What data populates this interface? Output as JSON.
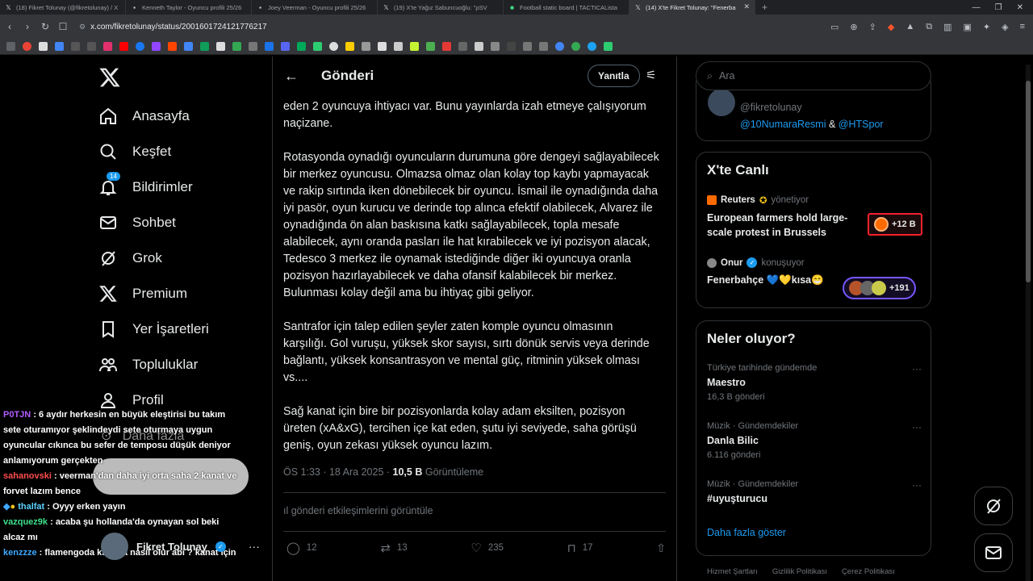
{
  "browser": {
    "tabs": [
      {
        "label": "(18) Fikret Tolunay (@fikretolunay) / X",
        "active": false
      },
      {
        "label": "Kenneth Taylor - Oyuncu profili 25/26",
        "active": false
      },
      {
        "label": "Joey Veerman - Oyuncu profili 25/26",
        "active": false
      },
      {
        "label": "(19) X'te Yağız Sabuncuoğlu: \"ρSV",
        "active": false
      },
      {
        "label": "Football static board | TACTICALista",
        "active": false
      },
      {
        "label": "(14) X'te Fikret Tolunay: \"Fenerba",
        "active": true
      }
    ],
    "url": "x.com/fikretolunay/status/2001601724121776217"
  },
  "nav": {
    "items": [
      {
        "label": "Anasayfa",
        "icon": "home-icon"
      },
      {
        "label": "Keşfet",
        "icon": "search-icon"
      },
      {
        "label": "Bildirimler",
        "icon": "bell-icon",
        "badge": "14"
      },
      {
        "label": "Sohbet",
        "icon": "mail-icon"
      },
      {
        "label": "Grok",
        "icon": "grok-icon"
      },
      {
        "label": "Premium",
        "icon": "x-icon"
      },
      {
        "label": "Yer İşaretleri",
        "icon": "bookmark-icon"
      },
      {
        "label": "Topluluklar",
        "icon": "communities-icon"
      },
      {
        "label": "Profil",
        "icon": "person-icon"
      }
    ],
    "more_label": "Daha fazla",
    "account_name": "Fikret Tolunay"
  },
  "chat": [
    {
      "user": "P0TJN",
      "text": ": 6 aydır herkesin en büyük eleştirisi bu takım sete oturamıyor şeklindeydi sete oturmaya uygun oyuncular cıkınca bu sefer de temposu düşük deniyor anlamıyorum gerçekten",
      "cls": "u1"
    },
    {
      "user": "sahanovski",
      "text": ": veerman'dan daha iyi orta saha 2 kanat ve forvet lazım bence",
      "cls": "u2"
    },
    {
      "user": "thalfat",
      "text": ": Oyyy erken yayın",
      "cls": "u3"
    },
    {
      "user": "vazquez9k",
      "text": ": acaba şu hollanda'da oynayan sol beki alcaz mı",
      "cls": "u4"
    },
    {
      "user": "kenzzze",
      "text": ": flamengoda ki plata nasıl olur abi ? kanat için",
      "cls": "u5"
    }
  ],
  "post": {
    "header_title": "Gönderi",
    "reply_label": "Yanıtla",
    "paragraphs": [
      "eden 2 oyuncuya ihtiyacı var. Bunu yayınlarda izah etmeye çalışıyorum\nnaçizane.",
      "Rotasyonda oynadığı oyuncuların durumuna göre dengeyi sağlayabilecek\nbir merkez oyuncusu. Olmazsa olmaz olan kolay top kaybı yapmayacak\nve rakip sırtında iken dönebilecek bir oyuncu. İsmail ile oynadığında daha\niyi pasör, oyun kurucu ve derinde top alınca efektif olabilecek, Alvarez ile\noynadığında ön alan baskısına katkı sağlayabilecek, topla mesafe\nalabilecek, aynı oranda pasları ile hat kırabilecek ve iyi pozisyon alacak,\nTedesco 3 merkez ile oynamak istediğinde diğer iki oyuncuya oranla\npozisyon hazırlayabilecek ve daha ofansif kalabilecek bir merkez.\nBulunması kolay değil ama bu ihtiyaç gibi geliyor.",
      "Santrafor için talep edilen şeyler zaten komple oyuncu olmasının\nkarşılığı. Gol vuruşu, yüksek skor sayısı, sırtı dönük servis veya derinde\nbağlantı, yüksek konsantrasyon ve mental güç, ritminin yüksek olması\nvs....",
      "Sağ kanat için bire bir pozisyonlarda kolay adam eksilten, pozisyon\nüreten (xA&xG), tercihen içe kat eden, şutu iyi seviyede, saha görüşü\ngeniş, oyun zekası yüksek oyuncu lazım."
    ],
    "time": "ÖS 1:33 · 18 Ara 2025 ·",
    "views": "10,5 B",
    "views_label": "Görüntüleme",
    "engagements_label": "gönderi etkileşimlerini görüntüle",
    "replies": "12",
    "reposts": "13",
    "likes": "235",
    "bookmarks": "17"
  },
  "right": {
    "search_placeholder": "Ara",
    "profile_handle": "@fikretolunay",
    "mention1": "@10NumaraResmi",
    "mention_and": "&",
    "mention2": "@HTSpor",
    "live": {
      "title": "X'te Canlı",
      "items": [
        {
          "source": "Reuters",
          "role": "yönetiyor",
          "title": "European farmers hold large-scale protest in Brussels",
          "count": "+12 B"
        },
        {
          "source": "Onur",
          "role": "konuşuyor",
          "title": "Fenerbahçe 💙💛kısa😁",
          "count": "+191"
        }
      ]
    },
    "trends": {
      "title": "Neler oluyor?",
      "items": [
        {
          "cat": "Türkiye tarihinde gündemde",
          "name": "Maestro",
          "count": "16,3 B gönderi"
        },
        {
          "cat": "Müzik · Gündemdekiler",
          "name": "Danla Bilic",
          "count": "6.116 gönderi"
        },
        {
          "cat": "Müzik · Gündemdekiler",
          "name": "#uyuşturucu",
          "count": ""
        }
      ],
      "show_more": "Daha fazla göster"
    },
    "footer": [
      "Hizmet Şartları",
      "Gizlilik Politikası",
      "Çerez Politikası"
    ]
  }
}
